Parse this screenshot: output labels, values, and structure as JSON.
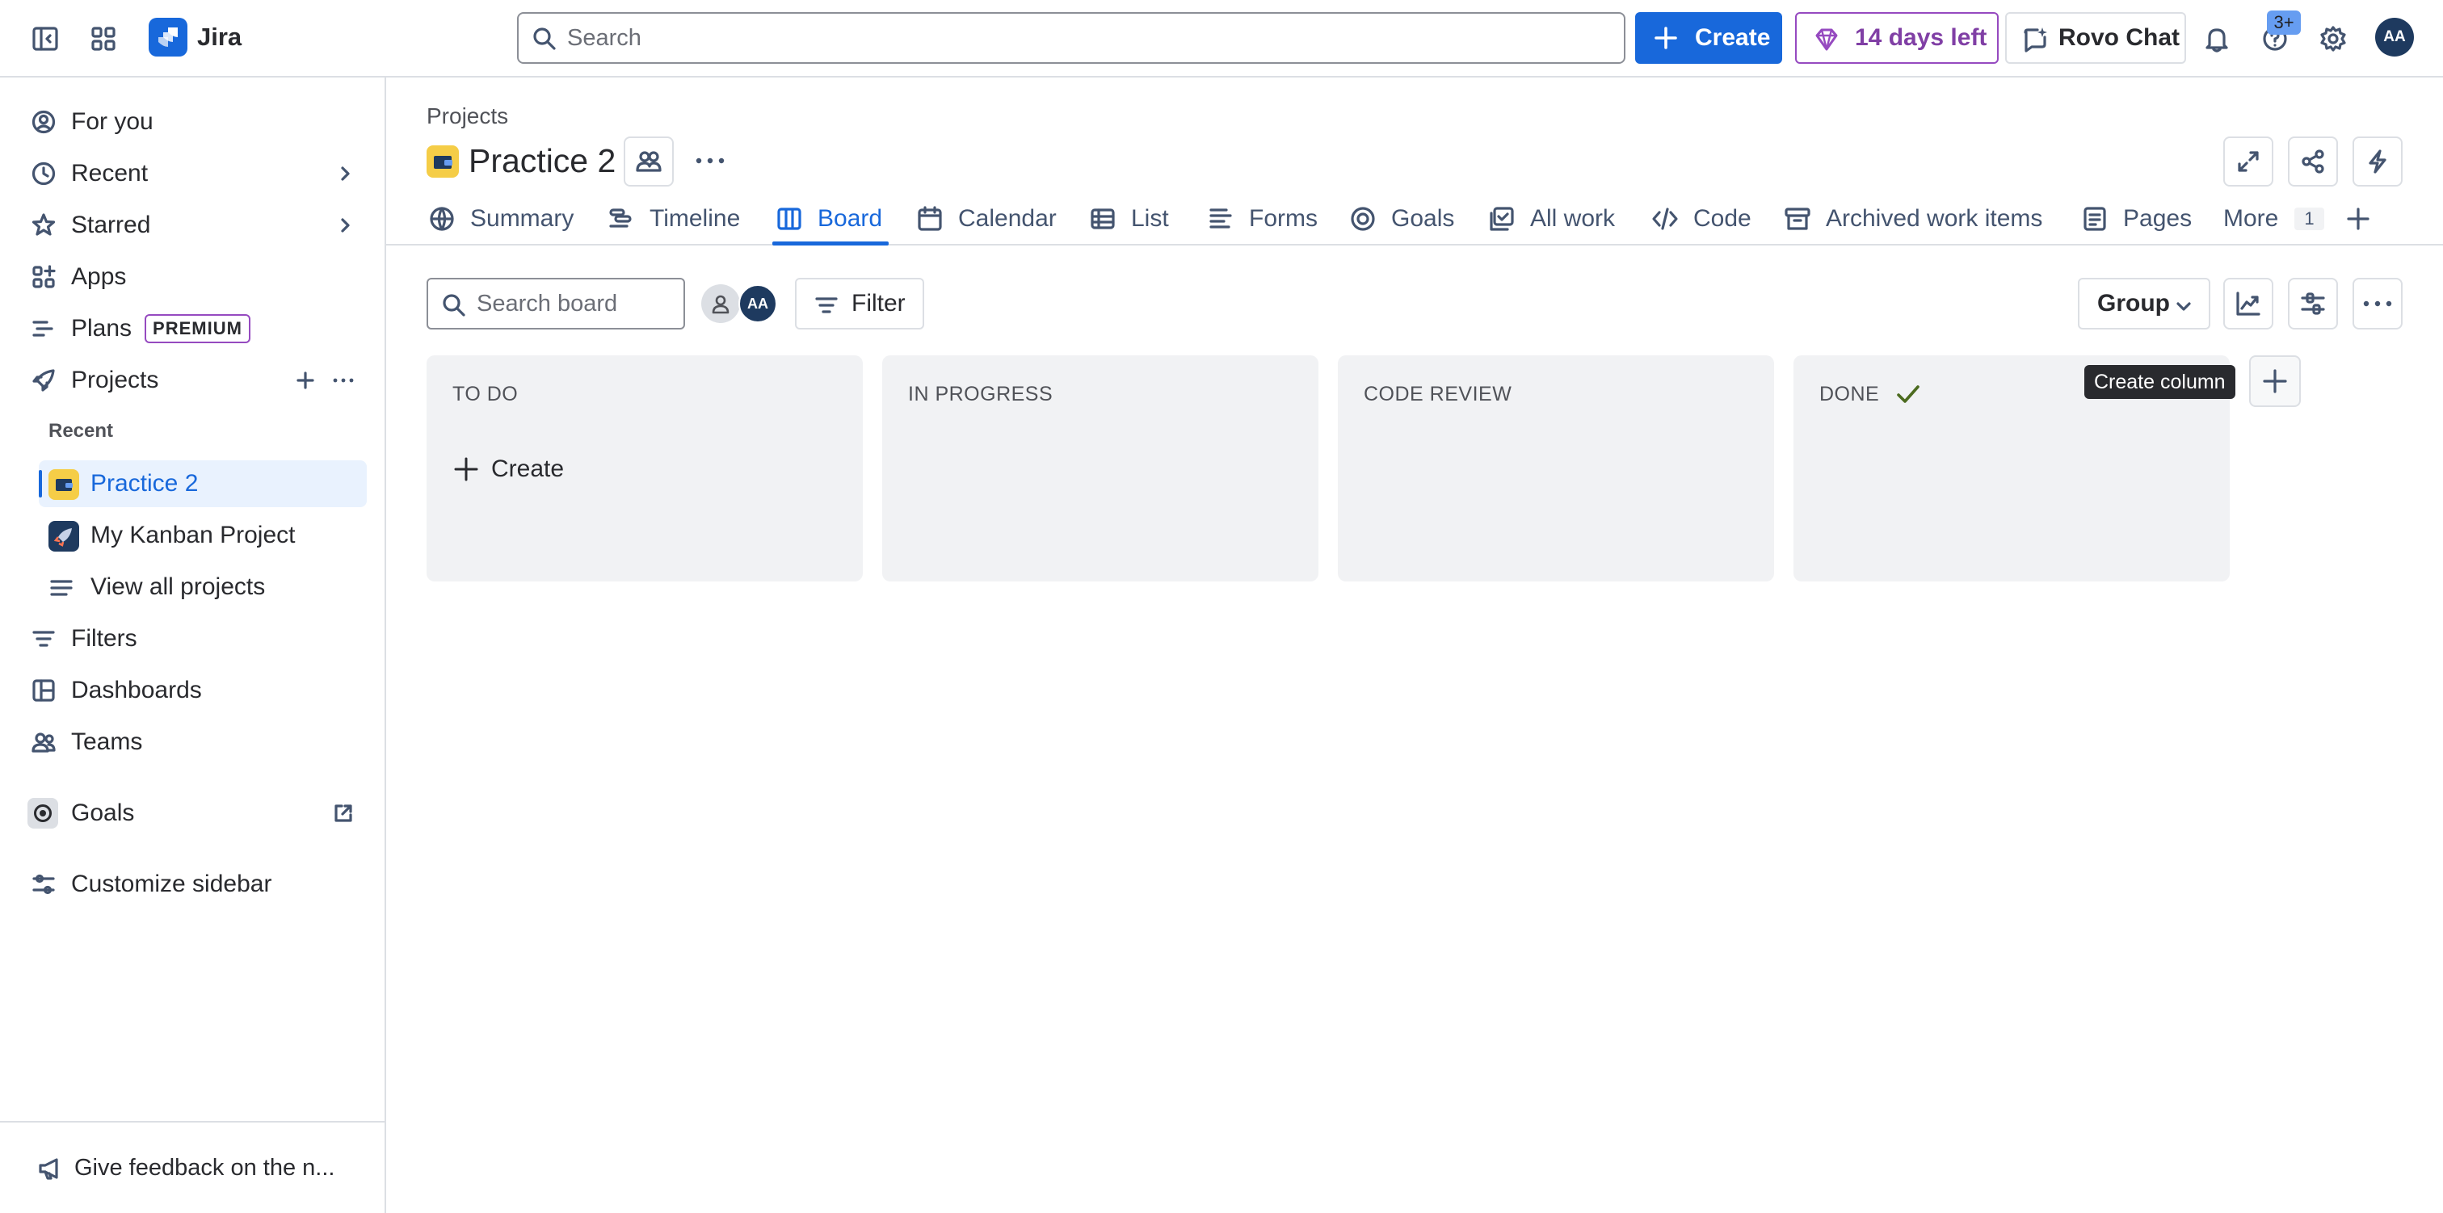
{
  "topbar": {
    "app_name": "Jira",
    "search_placeholder": "Search",
    "create_label": "Create",
    "trial_label": "14 days left",
    "rovo_label": "Rovo Chat",
    "help_badge": "3+",
    "avatar_initials": "AA"
  },
  "sidebar": {
    "items": [
      {
        "label": "For you"
      },
      {
        "label": "Recent"
      },
      {
        "label": "Starred"
      },
      {
        "label": "Apps"
      },
      {
        "label": "Plans",
        "lozenge": "PREMIUM"
      },
      {
        "label": "Projects"
      },
      {
        "label": "Filters"
      },
      {
        "label": "Dashboards"
      },
      {
        "label": "Teams"
      },
      {
        "label": "Goals"
      },
      {
        "label": "Customize sidebar"
      }
    ],
    "recent_heading": "Recent",
    "recent_projects": [
      {
        "label": "Practice 2",
        "active": true
      },
      {
        "label": "My Kanban Project",
        "active": false
      }
    ],
    "view_all_label": "View all projects",
    "feedback_label": "Give feedback on the n..."
  },
  "header": {
    "breadcrumb": "Projects",
    "project_title": "Practice 2"
  },
  "tabs": [
    {
      "label": "Summary",
      "icon": "globe-icon"
    },
    {
      "label": "Timeline",
      "icon": "timeline-icon"
    },
    {
      "label": "Board",
      "icon": "board-icon",
      "active": true
    },
    {
      "label": "Calendar",
      "icon": "calendar-icon"
    },
    {
      "label": "List",
      "icon": "list-icon"
    },
    {
      "label": "Forms",
      "icon": "forms-icon"
    },
    {
      "label": "Goals",
      "icon": "goal-icon"
    },
    {
      "label": "All work",
      "icon": "all-work-icon"
    },
    {
      "label": "Code",
      "icon": "code-icon"
    },
    {
      "label": "Archived work items",
      "icon": "archive-icon"
    },
    {
      "label": "Pages",
      "icon": "pages-icon"
    },
    {
      "label": "More",
      "count": "1"
    }
  ],
  "toolbar": {
    "search_placeholder": "Search board",
    "avatar_initials": "AA",
    "filter_label": "Filter",
    "group_label": "Group"
  },
  "board": {
    "columns": [
      {
        "title": "TO DO"
      },
      {
        "title": "IN PROGRESS"
      },
      {
        "title": "CODE REVIEW"
      },
      {
        "title": "DONE"
      }
    ],
    "create_label": "Create",
    "tooltip": "Create column"
  },
  "colors": {
    "accent": "#1868db",
    "trial": "#964ac0",
    "column_bg": "#f1f2f4",
    "project_icon": "#f5cd47"
  }
}
